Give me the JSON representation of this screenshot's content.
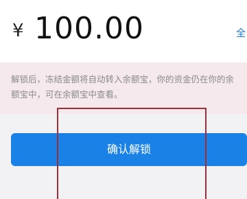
{
  "amount": {
    "currency_symbol": "¥",
    "value": "100.00",
    "all_label": "全"
  },
  "notice": {
    "line1": "解锁后，冻结金额将自动转入余额宝，你的资金仍在你的余",
    "line2": "额宝中，可在余额宝中查看。",
    "overlay_text": ""
  },
  "actions": {
    "confirm_label": "确认解锁"
  },
  "colors": {
    "accent": "#1a82e6",
    "notice_bg": "#f5e9ee",
    "highlight_frame": "#9d2d36"
  }
}
